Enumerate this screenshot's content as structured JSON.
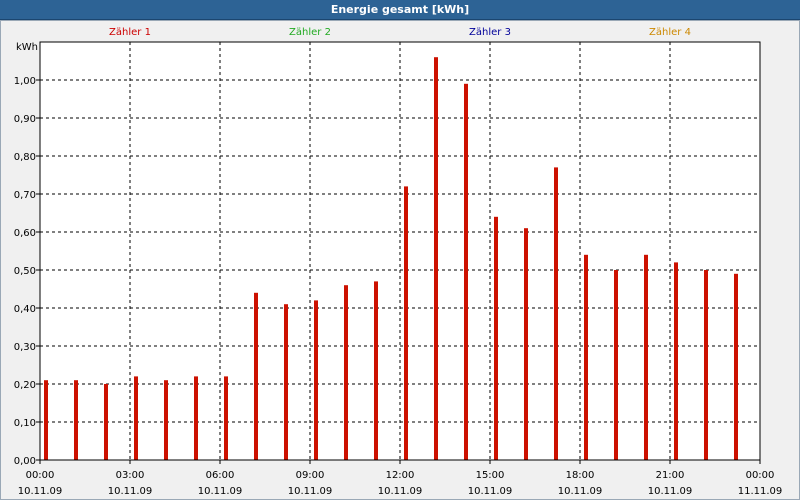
{
  "window": {
    "title": "Energie gesamt [kWh]"
  },
  "colors": {
    "titlebar": "#2d6395",
    "bar": "#cc1100",
    "background": "#f0f0f0",
    "plot_background": "#ffffff"
  },
  "legend": [
    {
      "label": "Zähler 1",
      "color": "#cc0000"
    },
    {
      "label": "Zähler 2",
      "color": "#22aa22"
    },
    {
      "label": "Zähler 3",
      "color": "#000099"
    },
    {
      "label": "Zähler 4",
      "color": "#cc8800"
    }
  ],
  "chart_data": {
    "type": "bar",
    "title": "Energie gesamt [kWh]",
    "ylabel": "kWh",
    "xlabel": "",
    "ylim": [
      0,
      1.1
    ],
    "y_ticks": [
      "0,00",
      "0,10",
      "0,20",
      "0,30",
      "0,40",
      "0,50",
      "0,60",
      "0,70",
      "0,80",
      "0,90",
      "1,00"
    ],
    "x_ticks": [
      {
        "time": "00:00",
        "date": "10.11.09"
      },
      {
        "time": "03:00",
        "date": "10.11.09"
      },
      {
        "time": "06:00",
        "date": "10.11.09"
      },
      {
        "time": "09:00",
        "date": "10.11.09"
      },
      {
        "time": "12:00",
        "date": "10.11.09"
      },
      {
        "time": "15:00",
        "date": "10.11.09"
      },
      {
        "time": "18:00",
        "date": "10.11.09"
      },
      {
        "time": "21:00",
        "date": "10.11.09"
      },
      {
        "time": "00:00",
        "date": "11.11.09"
      }
    ],
    "grid": true,
    "legend_position": "top",
    "categories": [
      "00:00",
      "01:00",
      "02:00",
      "03:00",
      "04:00",
      "05:00",
      "06:00",
      "07:00",
      "08:00",
      "09:00",
      "10:00",
      "11:00",
      "12:00",
      "13:00",
      "14:00",
      "15:00",
      "16:00",
      "17:00",
      "18:00",
      "19:00",
      "20:00",
      "21:00",
      "22:00",
      "23:00"
    ],
    "series": [
      {
        "name": "Zähler 1",
        "values": [
          0.21,
          0.21,
          0.2,
          0.22,
          0.21,
          0.22,
          0.22,
          0.44,
          0.41,
          0.42,
          0.46,
          0.47,
          0.72,
          1.06,
          0.99,
          0.64,
          0.61,
          0.77,
          0.54,
          0.5,
          0.54,
          0.52,
          0.5,
          0.49
        ]
      }
    ]
  }
}
